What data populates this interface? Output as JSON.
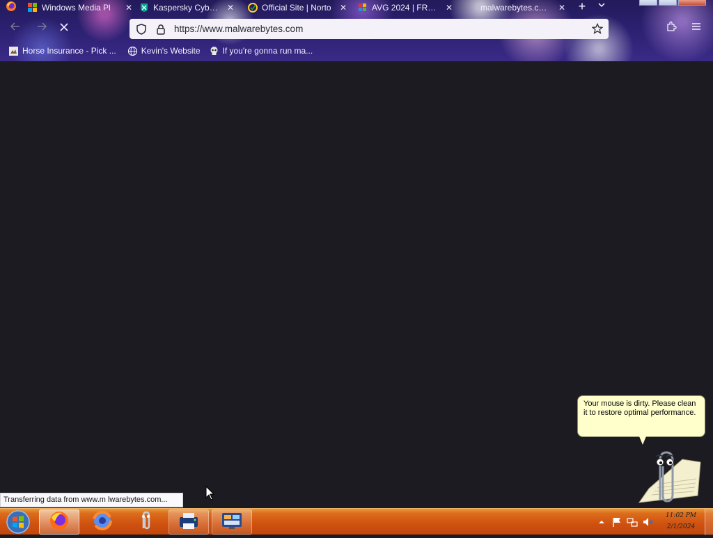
{
  "browser": {
    "tabs": [
      {
        "label": "Windows Media Pl",
        "icon": "microsoft-icon"
      },
      {
        "label": "Kaspersky Cyber S",
        "icon": "kaspersky-icon"
      },
      {
        "label": "Official Site | Norto",
        "icon": "norton-icon"
      },
      {
        "label": "AVG 2024 | FREE A",
        "icon": "avg-icon"
      },
      {
        "label": "malwarebytes.com/",
        "icon": "loading-icon",
        "active": true
      }
    ],
    "url": "https://www.malwarebytes.com",
    "bookmarks": [
      {
        "label": "Horse Insurance - Pick ...",
        "icon": "bookmark-page-icon"
      },
      {
        "label": "Kevin's Website",
        "icon": "globe-icon"
      },
      {
        "label": "If you're gonna run ma...",
        "icon": "skull-icon"
      }
    ],
    "status_text": "Transferring data from www.m lwarebytes.com..."
  },
  "assistant": {
    "message": "Your mouse is dirty. Please clean it to restore optimal performance."
  },
  "taskbar": {
    "items": [
      {
        "name": "firefox",
        "state": "active"
      },
      {
        "name": "browser-2",
        "state": "pinned"
      },
      {
        "name": "clippy",
        "state": "pinned"
      },
      {
        "name": "printer",
        "state": "open"
      },
      {
        "name": "control-panel",
        "state": "open"
      }
    ],
    "clock_time": "11:02 PM",
    "clock_date": "2/1/2024"
  },
  "colors": {
    "content_bg": "#1c1b22",
    "taskbar": "#cf5110",
    "bubble": "#ffffcc"
  }
}
